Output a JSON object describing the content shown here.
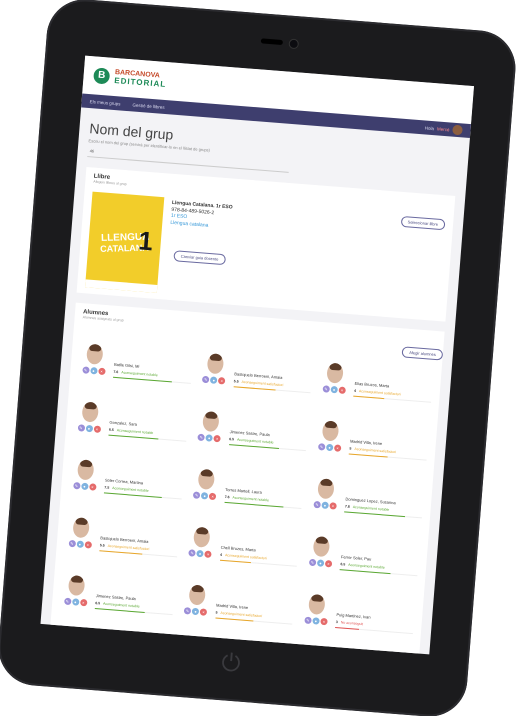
{
  "colors": {
    "accent": "#3e3e6e",
    "notable": "#5aa832",
    "sufficient": "#e8a628",
    "fail": "#e05252"
  },
  "header": {
    "brand_line1": "BARCANOVA",
    "brand_line2": "EDITORIAL"
  },
  "nav": {
    "item1": "Els meus grups",
    "item2": "Gestió de llibres",
    "user_prefix": "Hola",
    "user_name": "Mercè"
  },
  "page": {
    "title": "Nom del grup",
    "subtitle": "Escriu el nom del grup (servirà per identificar-lo en el llistat de grups)",
    "name_value": "4ti"
  },
  "books": {
    "heading": "Llibre",
    "helper": "Afegeix llibres al grup",
    "select_button": "Seleccionar llibre",
    "change_button": "Canviar guia docente",
    "item": {
      "cover_line1": "LLENGUA",
      "cover_line2": "CATALANA",
      "cover_number": "1",
      "title": "Llengua Catalana. 1r ESO",
      "isbn": "978-84-489-5026-2",
      "level": "1r ESO",
      "subject": "Llengua catalana"
    }
  },
  "students": {
    "heading": "Alumnes",
    "helper": "Alumnes assignats al grup",
    "add_button": "Afegir alumnes",
    "list": [
      {
        "name": "Batlle Gilsi, Mi",
        "grade": "7.6",
        "label": "Aconseguiment notable",
        "level": "notable",
        "progress": 0.76
      },
      {
        "name": "Bastojuelo Berroeni, Amaia",
        "grade": "5.5",
        "label": "Aconseguiment satisfactori",
        "level": "sufficient",
        "progress": 0.55
      },
      {
        "name": "Elias Bruzos, Marta",
        "grade": "4",
        "label": "Aconseguiment satisfactori",
        "level": "sufficient",
        "progress": 0.4
      },
      {
        "name": "Gonzalez, Sara",
        "grade": "6.5",
        "label": "Aconseguiment notable",
        "level": "notable",
        "progress": 0.65
      },
      {
        "name": "Jimenez Sastre, Paula",
        "grade": "6.5",
        "label": "Aconseguiment notable",
        "level": "notable",
        "progress": 0.65
      },
      {
        "name": "Madrid Villa, Irene",
        "grade": "5",
        "label": "Aconseguiment satisfactori",
        "level": "sufficient",
        "progress": 0.5
      },
      {
        "name": "Soler Correa, Martina",
        "grade": "7.5",
        "label": "Aconseguiment notable",
        "level": "notable",
        "progress": 0.75
      },
      {
        "name": "Torres Martell, Laura",
        "grade": "7.6",
        "label": "Aconseguiment notable",
        "level": "notable",
        "progress": 0.76
      },
      {
        "name": "Dominguez Lopez, Susanna",
        "grade": "7.8",
        "label": "Aconseguiment notable",
        "level": "notable",
        "progress": 0.78
      },
      {
        "name": "Bastojuelo Berroeni, Amaia",
        "grade": "5.5",
        "label": "Aconseguiment satisfactori",
        "level": "sufficient",
        "progress": 0.55
      },
      {
        "name": "Chell Bruzes, Marta",
        "grade": "4",
        "label": "Aconseguiment satisfactori",
        "level": "sufficient",
        "progress": 0.4
      },
      {
        "name": "Ferrer Soler, Pau",
        "grade": "6.5",
        "label": "Aconseguiment notable",
        "level": "notable",
        "progress": 0.65
      },
      {
        "name": "Jimenez Sastre, Paula",
        "grade": "6.5",
        "label": "Aconseguiment notable",
        "level": "notable",
        "progress": 0.65
      },
      {
        "name": "Madrid Villa, Irene",
        "grade": "5",
        "label": "Aconseguiment satisfactori",
        "level": "sufficient",
        "progress": 0.5
      },
      {
        "name": "Puig Martinez, Ivan",
        "grade": "3",
        "label": "No aconseguit",
        "level": "fail",
        "progress": 0.3
      }
    ]
  }
}
